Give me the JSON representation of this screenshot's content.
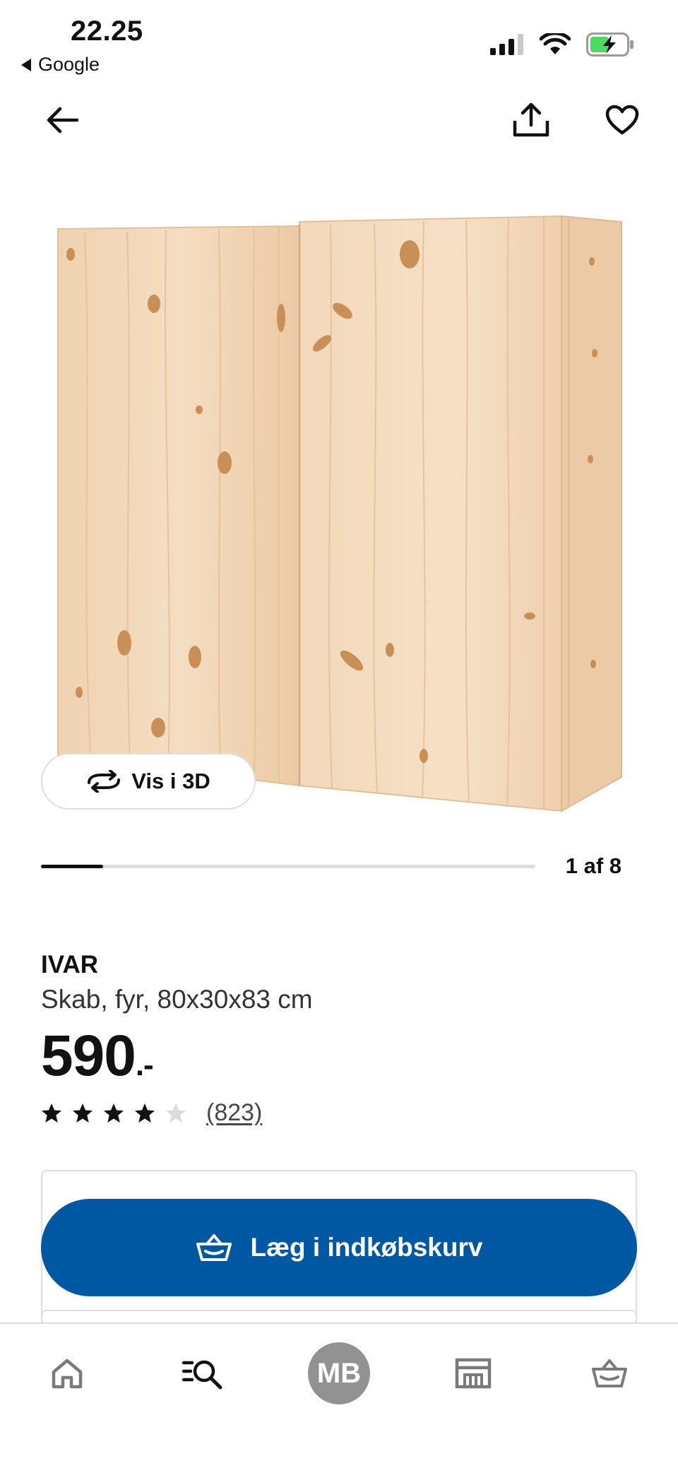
{
  "status_bar": {
    "time": "22.25",
    "back_app": "Google",
    "signal_icon": "signal-icon",
    "wifi_icon": "wifi-icon",
    "battery_icon": "battery-charging-icon"
  },
  "nav": {
    "back_icon": "arrow-left-icon",
    "share_icon": "share-icon",
    "favorite_icon": "heart-icon"
  },
  "gallery": {
    "view_3d_label": "Vis i 3D",
    "position_label": "1 af 8",
    "current": 1,
    "total": 8
  },
  "product": {
    "name": "IVAR",
    "description": "Skab, fyr, 80x30x83 cm",
    "price": "590",
    "price_suffix": ".-",
    "rating": 4,
    "rating_max": 5,
    "review_count": "(823)"
  },
  "cart": {
    "add_label": "Læg i indkøbskurv"
  },
  "tabbar": {
    "items": [
      {
        "icon": "home-icon"
      },
      {
        "icon": "search-icon"
      },
      {
        "icon": "avatar",
        "label": "MB"
      },
      {
        "icon": "store-icon"
      },
      {
        "icon": "basket-icon"
      }
    ]
  },
  "colors": {
    "primary": "#0058a3",
    "wood_light": "#f2d9bc",
    "wood_dark": "#dcb58f",
    "star": "#111111",
    "star_empty": "#dcdcdc"
  }
}
